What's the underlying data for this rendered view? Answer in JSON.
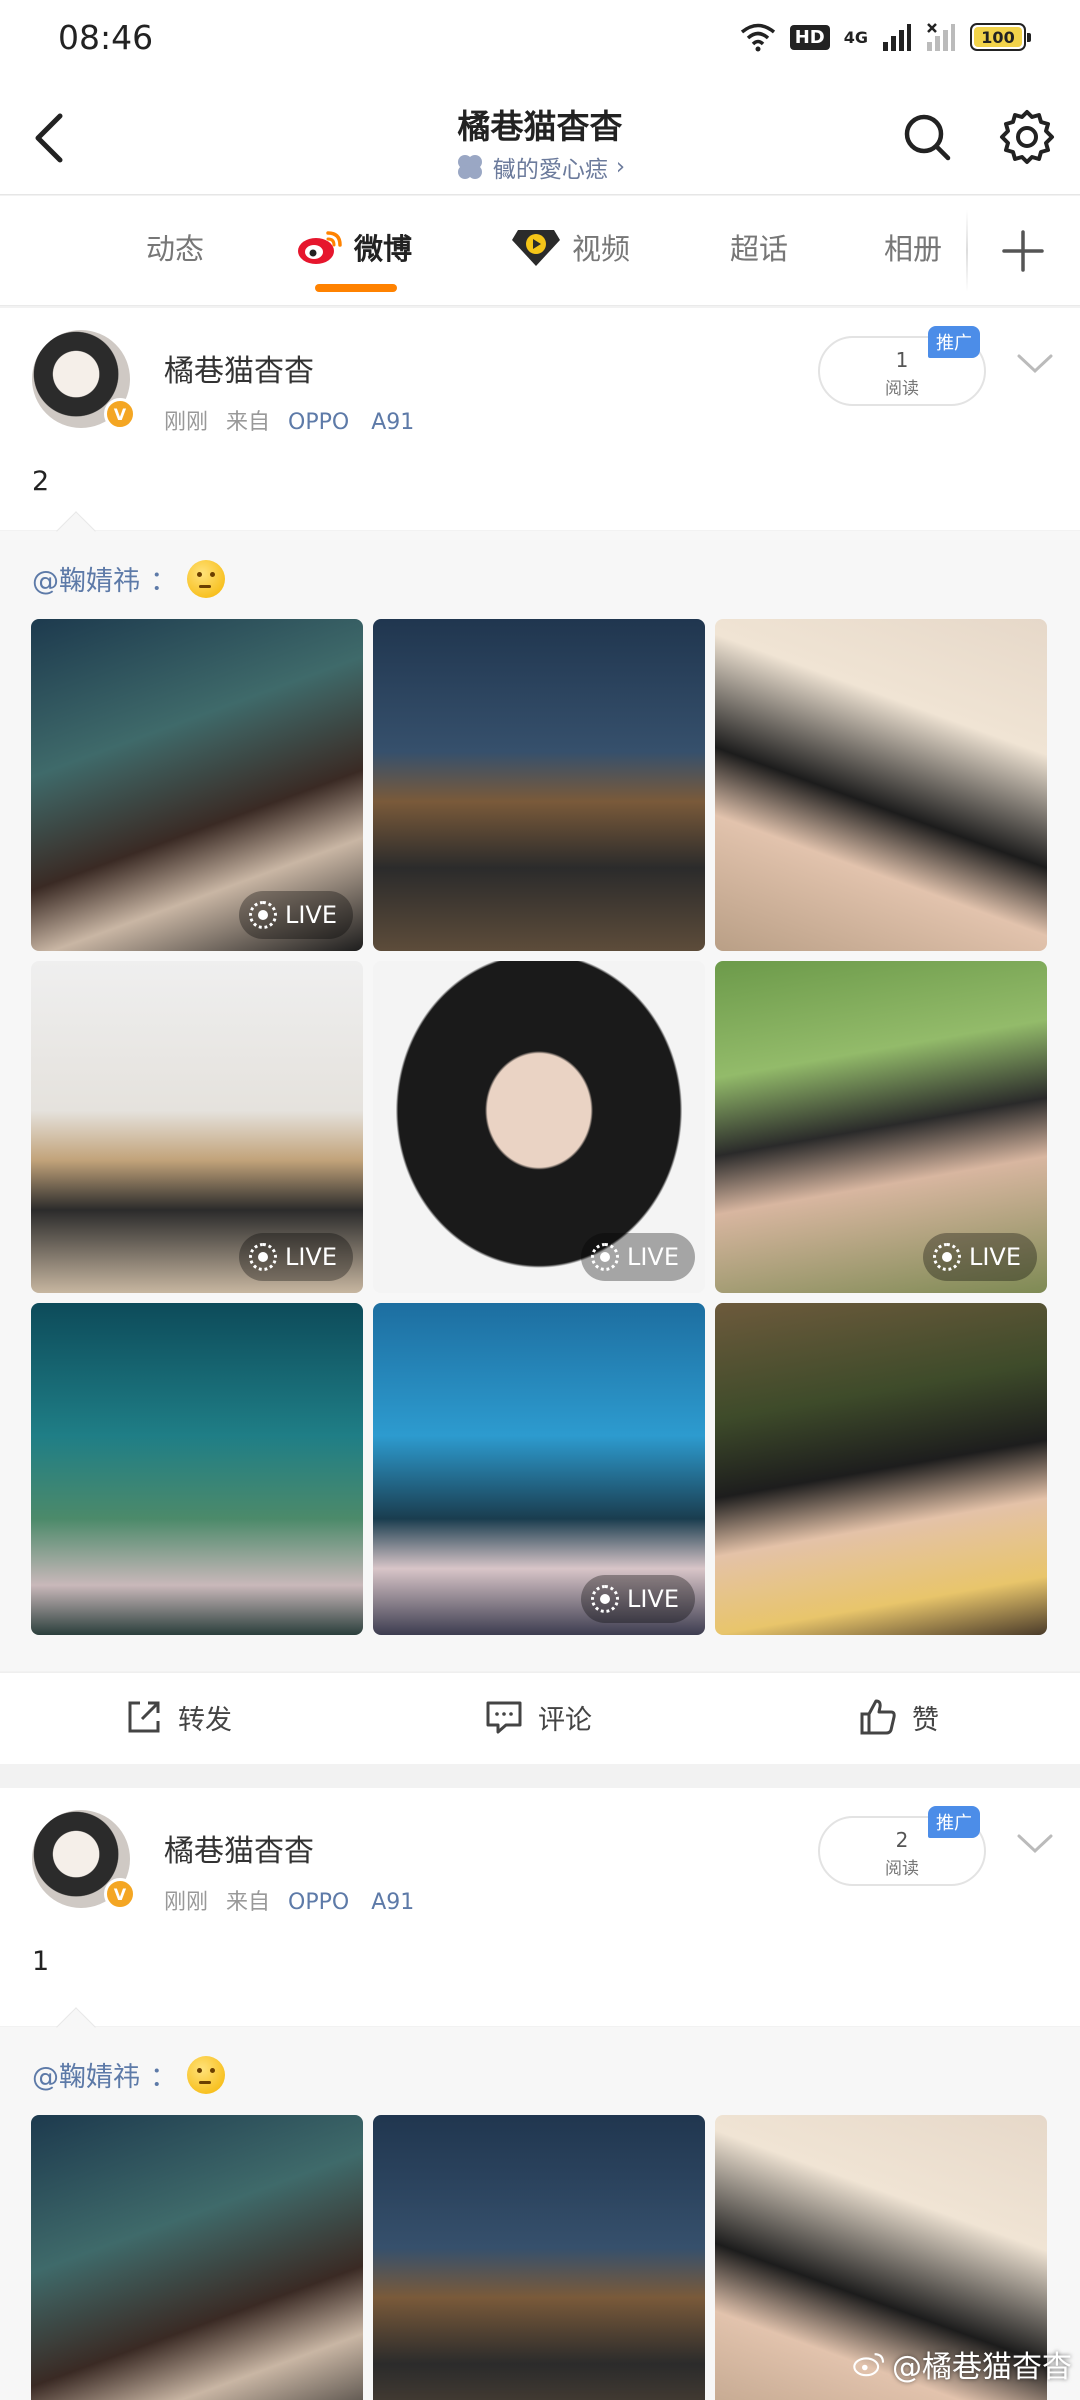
{
  "status_bar": {
    "time": "08:46",
    "hd_label": "HD",
    "network_label": "4G",
    "battery": "100"
  },
  "header": {
    "title": "橘巷猫杳杳",
    "subtitle": "㦽的愛心痣",
    "subtitle_arrow": "›"
  },
  "tabs": [
    {
      "label": "动态"
    },
    {
      "label": "微博"
    },
    {
      "label": "视频"
    },
    {
      "label": "超话"
    },
    {
      "label": "相册"
    }
  ],
  "posts": [
    {
      "author": "橘巷猫杳杳",
      "time": "刚刚",
      "source_prefix": "来自",
      "device": "OPPO　A91",
      "reads": "1",
      "reads_label": "阅读",
      "promo": "推广",
      "text": "2",
      "mention": "@鞠婧祎",
      "mention_suffix": "：",
      "photos_live": [
        true,
        true,
        false,
        true,
        true,
        true,
        false,
        true,
        false
      ],
      "live_label": "LIVE"
    },
    {
      "author": "橘巷猫杳杳",
      "time": "刚刚",
      "source_prefix": "来自",
      "device": "OPPO　A91",
      "reads": "2",
      "reads_label": "阅读",
      "promo": "推广",
      "text": "1",
      "mention": "@鞠婧祎",
      "mention_suffix": "："
    }
  ],
  "actions": {
    "repost": "转发",
    "comment": "评论",
    "like": "赞"
  },
  "watermark": "@橘巷猫杳杳",
  "colors": {
    "accent": "#ff8200",
    "link": "#5d7aa8",
    "promo": "#4c8de8",
    "verified": "#f4a623"
  }
}
